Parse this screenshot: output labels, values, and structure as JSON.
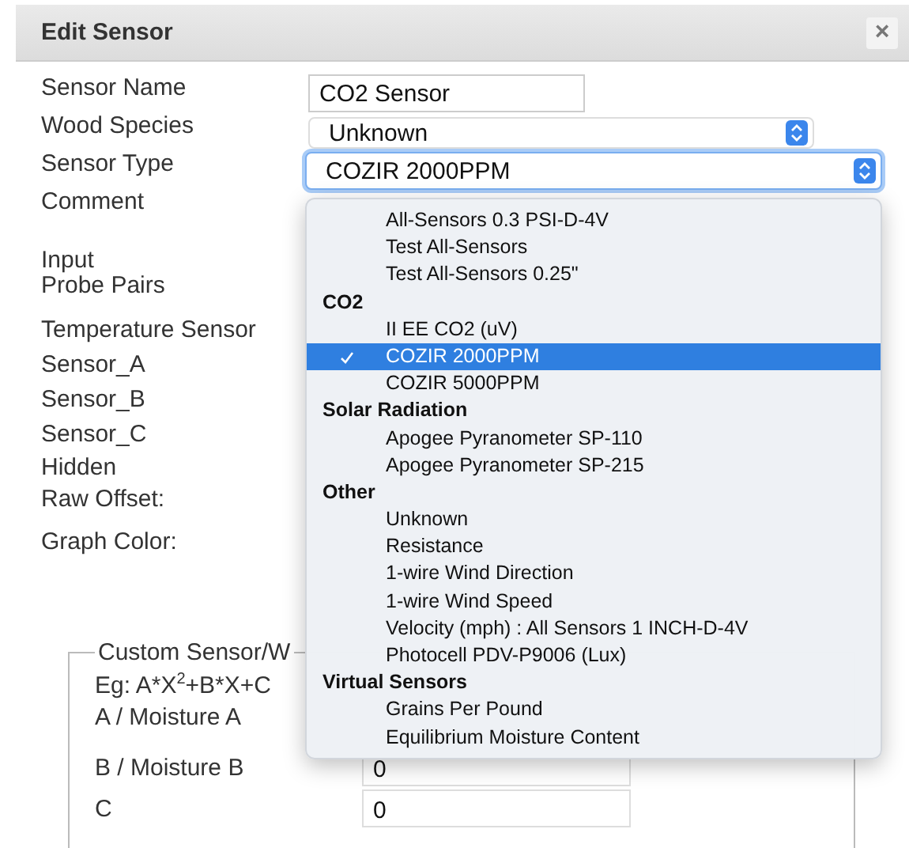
{
  "dialog": {
    "title": "Edit Sensor",
    "close": "×"
  },
  "labels": [
    "Sensor Name",
    "Wood Species",
    "Sensor Type",
    "Comment",
    "Input",
    "Probe Pairs",
    "Temperature Sensor",
    "Sensor_A",
    "Sensor_B",
    "Sensor_C",
    "Hidden",
    "Raw Offset:",
    "Graph Color:"
  ],
  "fields": {
    "sensor_name": "CO2 Sensor",
    "wood_species": "Unknown",
    "sensor_type": "COZIR 2000PPM"
  },
  "sensor_type_menu": {
    "items": [
      {
        "kind": "option",
        "label": "All-Sensors 0.3 PSI-D-4V",
        "selected": false
      },
      {
        "kind": "option",
        "label": "Test All-Sensors",
        "selected": false
      },
      {
        "kind": "option",
        "label": "Test All-Sensors 0.25\"",
        "selected": false
      },
      {
        "kind": "group",
        "label": "CO2"
      },
      {
        "kind": "option",
        "label": "II EE CO2 (uV)",
        "selected": false
      },
      {
        "kind": "option",
        "label": "COZIR 2000PPM",
        "selected": true
      },
      {
        "kind": "option",
        "label": "COZIR 5000PPM",
        "selected": false
      },
      {
        "kind": "group",
        "label": "Solar Radiation"
      },
      {
        "kind": "option",
        "label": "Apogee Pyranometer SP-110",
        "selected": false
      },
      {
        "kind": "option",
        "label": "Apogee Pyranometer SP-215",
        "selected": false
      },
      {
        "kind": "group",
        "label": "Other"
      },
      {
        "kind": "option",
        "label": "Unknown",
        "selected": false
      },
      {
        "kind": "option",
        "label": "Resistance",
        "selected": false
      },
      {
        "kind": "option",
        "label": "1-wire Wind Direction",
        "selected": false
      },
      {
        "kind": "option",
        "label": "1-wire Wind Speed",
        "selected": false
      },
      {
        "kind": "option",
        "label": "Velocity (mph) : All Sensors 1 INCH-D-4V",
        "selected": false
      },
      {
        "kind": "option",
        "label": "Photocell PDV-P9006 (Lux)",
        "selected": false
      },
      {
        "kind": "group",
        "label": "Virtual Sensors"
      },
      {
        "kind": "option",
        "label": "Grains Per Pound",
        "selected": false
      },
      {
        "kind": "option",
        "label": "Equilibrium Moisture Content",
        "selected": false
      }
    ]
  },
  "custom": {
    "legend": "Custom Sensor/W",
    "formula": "Eg: A*X$^{2}$+B*X+C",
    "rows": [
      {
        "label": "A / Moisture A"
      },
      {
        "label": "B / Moisture B",
        "value": "0"
      },
      {
        "label": "C",
        "value": "0"
      }
    ]
  }
}
